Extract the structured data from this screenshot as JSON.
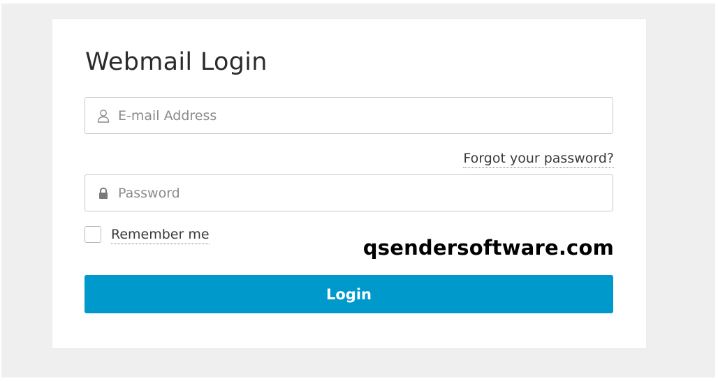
{
  "login_form": {
    "title": "Webmail Login",
    "email_field": {
      "placeholder": "E-mail Address",
      "value": "",
      "icon": "user-icon"
    },
    "forgot_password_link": "Forgot your password?",
    "password_field": {
      "placeholder": "Password",
      "value": "",
      "icon": "lock-icon"
    },
    "remember_me": {
      "label": "Remember me",
      "checked": false
    },
    "login_button_label": "Login"
  },
  "watermark": {
    "text": "qsendersoftware.com"
  },
  "colors": {
    "backdrop": "#efefef",
    "card": "#ffffff",
    "primary_button": "#0099cc",
    "border": "#c9c9c9",
    "title_text": "#2b2b2b",
    "placeholder_text": "#8a8a8a"
  }
}
